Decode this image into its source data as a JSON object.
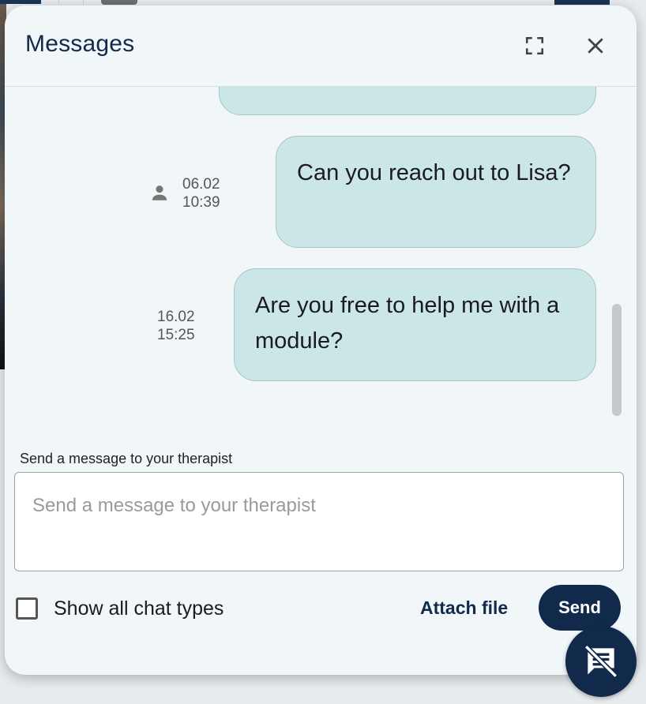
{
  "dialog": {
    "title": "Messages",
    "fullscreen_icon": "fullscreen-icon",
    "close_icon": "close-icon"
  },
  "messages": [
    {
      "text": "",
      "date": "",
      "time": "",
      "partial": true
    },
    {
      "text": "Can you reach out to Lisa?",
      "date": "06.02",
      "time": "10:39",
      "sender_icon": "person-icon"
    },
    {
      "text": "Are you free to help me with a module?",
      "date": "16.02",
      "time": "15:25"
    }
  ],
  "composer": {
    "label": "Send a message to your therapist",
    "placeholder": "Send a message to your therapist",
    "value": ""
  },
  "options": {
    "show_all_label": "Show all chat types",
    "show_all_checked": false
  },
  "actions": {
    "attach_label": "Attach file",
    "send_label": "Send"
  },
  "fab": {
    "icon": "chat-off-icon"
  },
  "colors": {
    "primary": "#112a4c",
    "bubble": "#cae6e7",
    "panel": "#f1f7f8"
  }
}
